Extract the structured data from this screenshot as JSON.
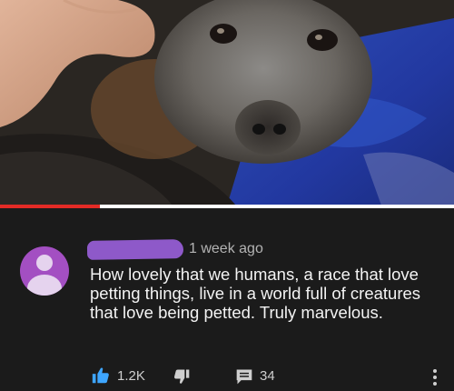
{
  "video": {
    "thumbnail_description_icon": "fruit-bat-photo",
    "progress_fraction": 0.22
  },
  "comment": {
    "avatar_icon": "default-user-avatar",
    "author_redacted": true,
    "timestamp": "1 week ago",
    "text": "How lovely that we humans, a race that love petting things, live in a world full of creatures that love being petted. Truly marvelous.",
    "likes": "1.2K",
    "replies": "34"
  },
  "icons": {
    "like": "thumbs-up-icon",
    "dislike": "thumbs-down-icon",
    "reply": "reply-icon",
    "more": "more-vertical-icon"
  },
  "colors": {
    "background": "#1b1b1b",
    "accent_blue": "#3ea6ff",
    "progress_red": "#e42b26",
    "avatar_purple": "#a34fc2",
    "redaction_purple": "#8e59c9"
  }
}
